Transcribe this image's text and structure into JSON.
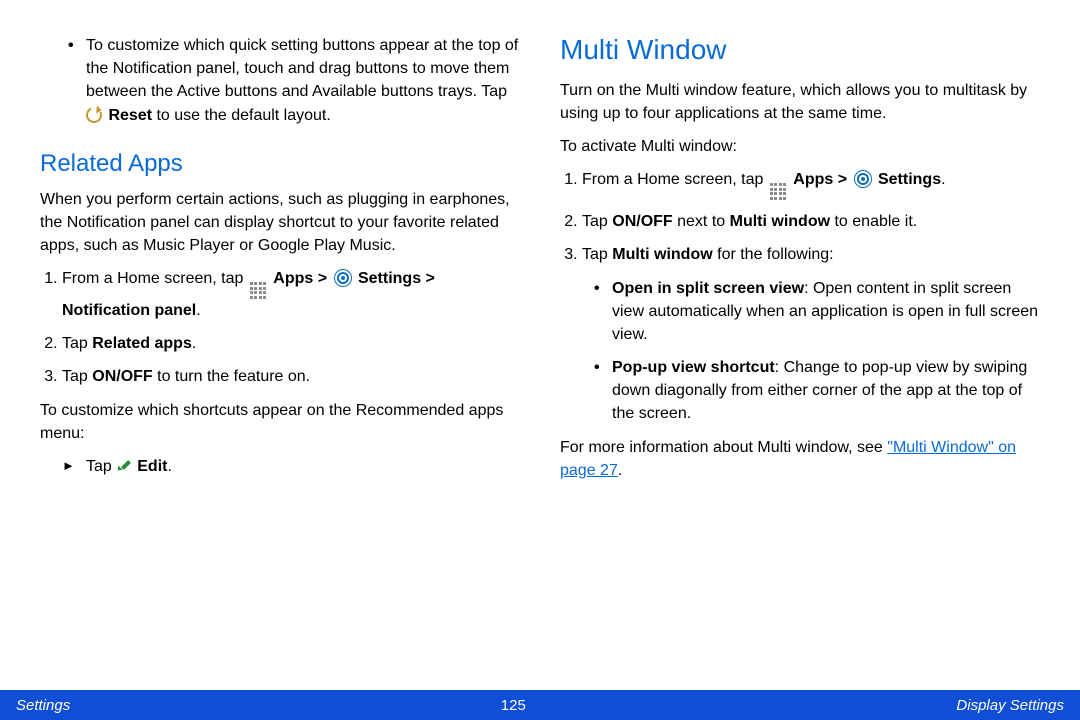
{
  "left": {
    "bulletTop": {
      "text": "To customize which quick setting buttons appear at the top of the Notification panel, touch and drag buttons to move them between the Active buttons and Available buttons trays. Tap ",
      "resetLabel": "Reset",
      "suffix": " to use the default layout."
    },
    "relatedAppsHeading": "Related Apps",
    "relatedAppsIntro": "When you perform certain actions, such as plugging in earphones, the Notification panel can display shortcut to your favorite related apps, such as Music Player or Google Play Music.",
    "steps": [
      {
        "prefix": "From a Home screen, tap ",
        "appsLabel": "Apps",
        "gt1": " > ",
        "settingsLabel": "Settings",
        "gt2": " > ",
        "notifLabel": "Notification panel",
        "dot": "."
      },
      {
        "prefix": "Tap ",
        "bold": "Related apps",
        "dot": "."
      },
      {
        "prefix": "Tap ",
        "bold": "ON/OFF",
        "suffix": " to turn the feature on."
      }
    ],
    "customizeIntro": "To customize which shortcuts appear on the Recommended apps menu:",
    "editRow": {
      "tap": "Tap ",
      "editLabel": "Edit",
      "dot": "."
    }
  },
  "right": {
    "heading": "Multi Window",
    "intro": "Turn on the Multi window feature, which allows you to multitask by using up to four applications at the same time.",
    "activateLine": "To activate Multi window:",
    "steps": [
      {
        "prefix": "From a Home screen, tap ",
        "appsLabel": "Apps",
        "gt": " > ",
        "settingsLabel": "Settings",
        "dot": "."
      },
      {
        "prefix": "Tap ",
        "bold1": "ON/OFF",
        "mid": " next to ",
        "bold2": "Multi window",
        "suffix": " to enable it."
      },
      {
        "prefix": "Tap ",
        "bold": "Multi window",
        "suffix": " for the following:"
      }
    ],
    "subBullets": [
      {
        "boldLead": "Open in split screen view",
        "rest": ": Open content in split screen view automatically when an application is open in full screen view."
      },
      {
        "boldLead": "Pop-up view shortcut",
        "rest": ": Change to pop-up view by swiping down diagonally from either corner of the app at the top of the screen."
      }
    ],
    "moreInfoPrefix": "For more information about Multi window, see ",
    "linkText": "\"Multi Window\" on page 27",
    "moreInfoSuffix": "."
  },
  "footer": {
    "left": "Settings",
    "center": "125",
    "right": "Display Settings"
  }
}
